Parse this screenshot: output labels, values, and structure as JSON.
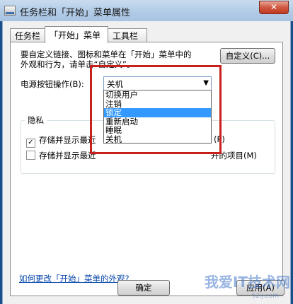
{
  "window": {
    "title": "任务栏和「开始」菜单属性",
    "close_label": "✕"
  },
  "tabs": [
    {
      "label": "任务栏"
    },
    {
      "label": "「开始」菜单"
    },
    {
      "label": "工具栏"
    }
  ],
  "customize": {
    "description_line1": "要自定义链接、图标和菜单在「开始」菜单中的",
    "description_line2": "外观和行为，请单击“自定义”。",
    "button_label": "自定义(C)..."
  },
  "power_button": {
    "label": "电源按钮操作(B):",
    "selected_value": "关机",
    "options": [
      "切换用户",
      "注销",
      "锁定",
      "重新启动",
      "睡眠",
      "关机"
    ],
    "highlighted_option": "锁定"
  },
  "privacy": {
    "title": "隐私",
    "items": [
      {
        "text": "存储并显示最近",
        "tail": "(P)",
        "checked": true
      },
      {
        "text": "存储并显示最近",
        "tail": "开的项目(M)",
        "checked": false
      }
    ]
  },
  "link_text": "如何更改「开始」菜单的外观?",
  "buttons": {
    "ok": "确定",
    "apply": "应用(A)"
  },
  "watermark": {
    "text": "我爱IT技术网",
    "sub": "52ij.com"
  }
}
